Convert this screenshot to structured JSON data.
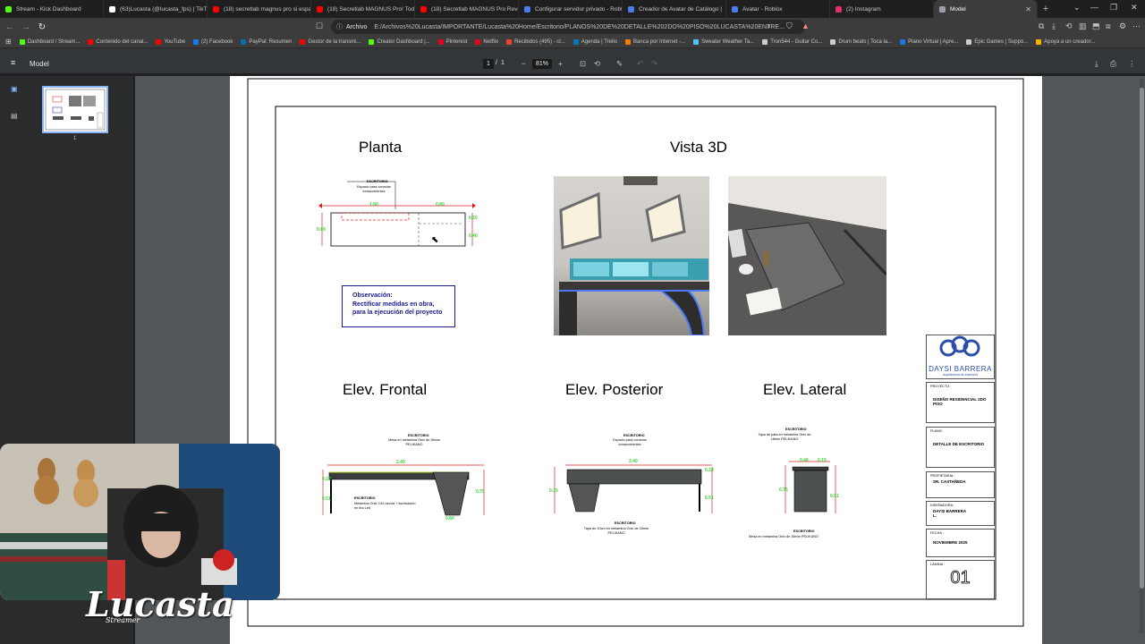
{
  "browser": {
    "tabs": [
      {
        "label": "Stream - Kick Dashboard",
        "color": "#53fc18"
      },
      {
        "label": "(63)Lucasta (@lucasta_fps) | TikTok",
        "color": "#ffffff"
      },
      {
        "label": "(18) secretlab magnus pro si espa",
        "color": "#ff0000"
      },
      {
        "label": "(18) Secretlab MAGNUS Pro! Tod",
        "color": "#ff0000"
      },
      {
        "label": "(18) Secretlab MAGNUS Pro Revi",
        "color": "#ff0000"
      },
      {
        "label": "Configurar servidor privado - Robl",
        "color": "#4b7bec"
      },
      {
        "label": "Creador de Avatar de Catálogo |",
        "color": "#4b7bec"
      },
      {
        "label": "Avatar - Roblox",
        "color": "#4b7bec"
      },
      {
        "label": "(2) Instagram",
        "color": "#e1306c"
      },
      {
        "label": "Model",
        "color": "#9aa0a6",
        "active": true
      }
    ],
    "new_tab": "+",
    "window_controls": {
      "chevron": "⌄",
      "minimize": "—",
      "restore": "❐",
      "close": "✕"
    },
    "address": {
      "label": "Archivo",
      "url": "E:/Archivos%20Lucasta/IMPORTANTE/Lucasta%20Home/Escritorio/PLANOS%20DE%20DETALLE%202DO%20PISO%20LUCASTA%20ENTRE..."
    },
    "bookmarks": [
      {
        "label": "Dashboard / Stream...",
        "color": "#53fc18"
      },
      {
        "label": "Contenido del canal...",
        "color": "#ff0000"
      },
      {
        "label": "YouTube",
        "color": "#ff0000"
      },
      {
        "label": "(2) Facebook",
        "color": "#1877f2"
      },
      {
        "label": "PayPal: Resumen",
        "color": "#0070ba"
      },
      {
        "label": "Gestor de la transmi...",
        "color": "#ff0000"
      },
      {
        "label": "Creator Dashboard |...",
        "color": "#53fc18"
      },
      {
        "label": "Pinterest",
        "color": "#e60023"
      },
      {
        "label": "Netflix",
        "color": "#e50914"
      },
      {
        "label": "Recibidos (495) - cl...",
        "color": "#ea4335"
      },
      {
        "label": "Agenda | Trello",
        "color": "#0079bf"
      },
      {
        "label": "Banca por Internet -...",
        "color": "#f57c00"
      },
      {
        "label": "Sweater Weather Ta...",
        "color": "#4fc3f7"
      },
      {
        "label": "Tron544 - Guitar Co...",
        "color": "#cccccc"
      },
      {
        "label": "Drum beats | Toca la...",
        "color": "#cccccc"
      },
      {
        "label": "Piano Virtual | Apre...",
        "color": "#1a73e8"
      },
      {
        "label": "Epic Games | Suppo...",
        "color": "#cccccc"
      },
      {
        "label": "Apoya a un creador...",
        "color": "#f4b400"
      }
    ]
  },
  "pdf": {
    "title": "Model",
    "page_current": "1",
    "page_sep": "/",
    "page_total": "1",
    "zoom": "81%",
    "thumb_label": "1"
  },
  "sheet": {
    "planta": "Planta",
    "vista3d": "Vista 3D",
    "elev_frontal": "Elev. Frontal",
    "elev_posterior": "Elev. Posterior",
    "elev_lateral": "Elev. Lateral",
    "observacion_title": "Observación:",
    "observacion_line1": "Rectificar medidas en  obra,",
    "observacion_line2": "para la ejecución del proyecto",
    "plan_note_title": "ESCRITORIO",
    "plan_note_body": "Espacio para conectar tomacorrientes",
    "dims_plan": {
      "a": "1.60",
      "b": "0.80",
      "c": "0.60",
      "d": "0.15",
      "e": "0.40"
    },
    "front_top_note_title": "ESCRITORIO",
    "front_top_note_body": "Mesa en melamina Onix de 36mm PELIKANO",
    "front_bottom_note_title": "ESCRITORIO",
    "front_bottom_note_body": "Melamina Onix C/hl ranura + iluminación en tira Led",
    "front_dims": {
      "w": "2.40",
      "h1": "0.23",
      "h2": "0.51",
      "h3": "0.75",
      "b": "0.60"
    },
    "post_top_note_title": "ESCRITORIO",
    "post_top_note_body": "Espacio para conectar tomacorrientes",
    "post_bottom_note_title": "ESCRITORIO",
    "post_bottom_note_body": "Tapa de 20cm en melamina Onix de 18mm PELIKANO",
    "post_dims": {
      "w": "2.40",
      "h1": "0.75",
      "h2": "0.24",
      "h3": "0.51"
    },
    "lat_top_note_title": "ESCRITORIO",
    "lat_top_note_body": "Tapa de pata en melamina Onix de 18mm PELIKANO",
    "lat_bottom_note_title": "ESCRITORIO",
    "lat_bottom_note_body": "Mesa en melamina Onix de 36mm PELIKANO",
    "lat_dims": {
      "a": "0.46",
      "b": "0.15",
      "h1": "0.75",
      "h2": "0.51"
    }
  },
  "title_block": {
    "brand": "DAYSI BARRERA",
    "brand_sub": "Arquitectura de Interiores",
    "proyecto_label": "PROYECTO :",
    "proyecto_value": "DISEÑO RESIDENCIAL 2DO PISO",
    "plano_label": "PLANO:",
    "plano_value": "DETALLE DE ESCRITORIO",
    "propietario_label": "PROPIETARIA :",
    "propietario_value": "SR. CASTAÑEDA",
    "disenador_label": "DISEÑADORA :",
    "disenador_value": "DAYSI BARRERA L.",
    "fecha_label": "FECHA :",
    "fecha_value": "NOVIEMBRE 2025",
    "lamina_label": "LÁMINA :",
    "lamina_value": "01"
  },
  "overlay": {
    "streamer_logo": "Lucasta",
    "streamer_logo_sub": "Streamer"
  }
}
